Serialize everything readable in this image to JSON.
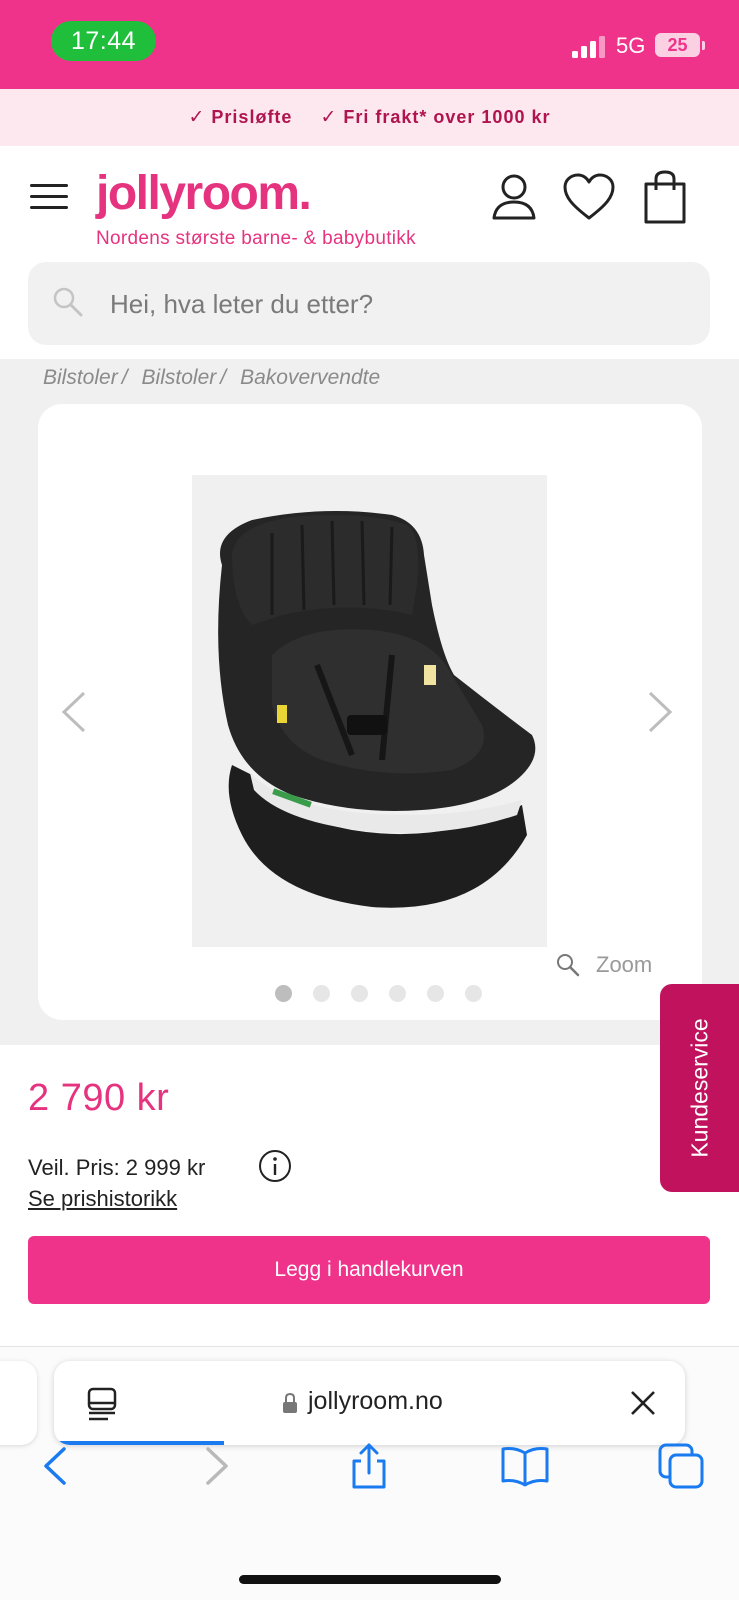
{
  "status_bar": {
    "time": "17:44",
    "network": "5G",
    "battery": "25"
  },
  "promo": {
    "items": [
      "Prisløfte",
      "Fri frakt* over 1000 kr"
    ]
  },
  "header": {
    "logo": "jollyroom.",
    "tagline": "Nordens største barne- & babybutikk",
    "search_placeholder": "Hei, hva leter du etter?"
  },
  "breadcrumb": [
    {
      "label": "Bilstoler",
      "sep": "/"
    },
    {
      "label": "Bilstoler",
      "sep": "/"
    },
    {
      "label": "Bakovervendte",
      "sep": ""
    }
  ],
  "gallery": {
    "zoom_label": "Zoom",
    "image_count": 6,
    "active_index": 0
  },
  "product": {
    "price": "2 790 kr",
    "rrp": "Veil. Pris: 2 999 kr",
    "history_link": "Se prishistorikk",
    "add_to_cart": "Legg i handlekurven"
  },
  "customer_service": {
    "label": "Kundeservice"
  },
  "browser": {
    "url": "jollyroom.no",
    "load_progress": 0.27
  },
  "colors": {
    "brand_pink": "#f0338a",
    "brand_text_pink": "#e6337f",
    "service_magenta": "#c1125e",
    "ios_blue": "#1a7af0"
  }
}
